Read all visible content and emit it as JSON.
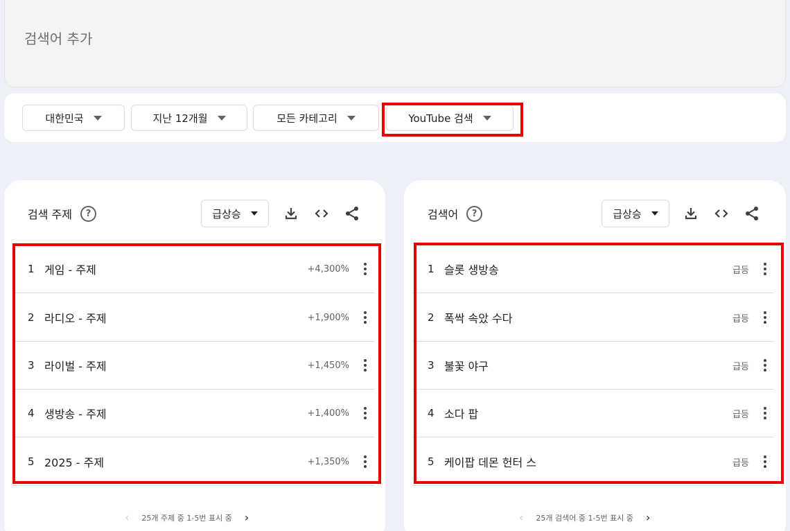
{
  "search": {
    "placeholder": "검색어 추가"
  },
  "filters": {
    "region": "대한민국",
    "time": "지난 12개월",
    "category": "모든 카테고리",
    "property": "YouTube 검색"
  },
  "left_card": {
    "title": "검색 주제",
    "sort_label": "급상승",
    "rows": [
      {
        "rank": "1",
        "label": "게임 - 주제",
        "value": "+4,300%"
      },
      {
        "rank": "2",
        "label": "라디오 - 주제",
        "value": "+1,900%"
      },
      {
        "rank": "3",
        "label": "라이벌 - 주제",
        "value": "+1,450%"
      },
      {
        "rank": "4",
        "label": "생방송 - 주제",
        "value": "+1,400%"
      },
      {
        "rank": "5",
        "label": "2025 - 주제",
        "value": "+1,350%"
      }
    ],
    "pagination": "25개 주제 중 1-5번 표시 중"
  },
  "right_card": {
    "title": "검색어",
    "sort_label": "급상승",
    "rows": [
      {
        "rank": "1",
        "label": "슬롯 생방송",
        "value": "급등"
      },
      {
        "rank": "2",
        "label": "폭싹 속았 수다",
        "value": "급등"
      },
      {
        "rank": "3",
        "label": "불꽃 야구",
        "value": "급등"
      },
      {
        "rank": "4",
        "label": "소다 팝",
        "value": "급등"
      },
      {
        "rank": "5",
        "label": "케이팝 데몬 헌터 스",
        "value": "급등"
      }
    ],
    "pagination": "25개 검색어 중 1-5번 표시 중"
  }
}
